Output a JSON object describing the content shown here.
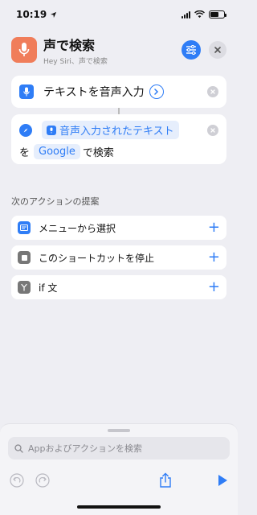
{
  "status_bar": {
    "time": "10:19"
  },
  "header": {
    "title": "声で検索",
    "subtitle": "Hey Siri、声で検索"
  },
  "actions": {
    "dictate": {
      "label": "テキストを音声入力"
    },
    "search": {
      "token": "音声入力されたテキスト",
      "prefix": "を",
      "engine": "Google",
      "suffix": "で検索"
    }
  },
  "suggestions": {
    "title": "次のアクションの提案",
    "items": [
      {
        "label": "メニューから選択"
      },
      {
        "label": "このショートカットを停止"
      },
      {
        "label": "if 文"
      }
    ]
  },
  "search_bar": {
    "placeholder": "Appおよびアクションを検索"
  },
  "colors": {
    "accent": "#2f7df6",
    "app_icon": "#f07d5a",
    "background": "#eeeef3"
  }
}
